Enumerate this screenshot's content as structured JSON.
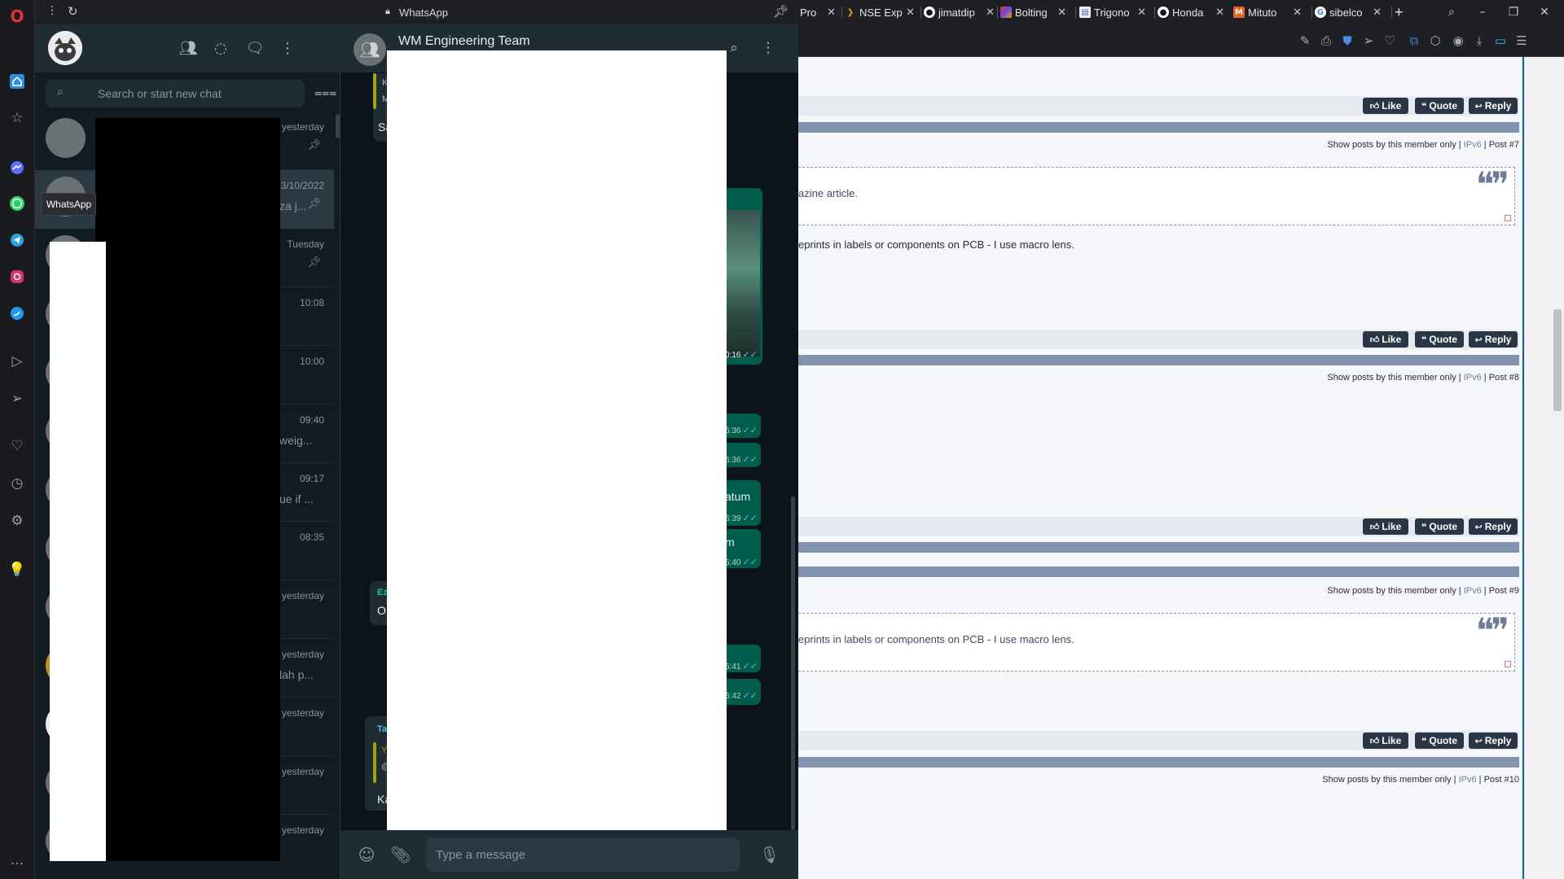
{
  "browser": {
    "tabs": [
      {
        "label": "Pro",
        "icon": "page-icon",
        "favicon_color": "#3d5a80"
      },
      {
        "label": "NSE Exp",
        "icon": "nse-icon",
        "favicon_color": "#f7a600"
      },
      {
        "label": "jimatdip",
        "icon": "github-icon",
        "favicon_color": "#ffffff"
      },
      {
        "label": "Bolting",
        "icon": "bolting-icon",
        "favicon_color": "#d6336c"
      },
      {
        "label": "Trigono",
        "icon": "doc-icon",
        "favicon_color": "#4a6fa5"
      },
      {
        "label": "Honda",
        "icon": "github-icon",
        "favicon_color": "#ffffff"
      },
      {
        "label": "Mituto",
        "icon": "m-icon",
        "favicon_color": "#e8631a"
      },
      {
        "label": "sibelco",
        "icon": "google-icon",
        "favicon_color": "#ffffff"
      }
    ],
    "new_tab_symbol": "+"
  },
  "whatsapp": {
    "window_title": "WhatsApp",
    "tooltip": "WhatsApp",
    "search_placeholder": "Search or start new chat",
    "chats": [
      {
        "time": "yesterday",
        "snippet": "",
        "pinned": true
      },
      {
        "time": "3/10/2022",
        "snippet": "za j...",
        "pinned": true
      },
      {
        "time": "Tuesday",
        "snippet": "",
        "pinned": true
      },
      {
        "time": "10:08",
        "snippet": "",
        "pinned": false
      },
      {
        "time": "10:00",
        "snippet": "",
        "pinned": false
      },
      {
        "time": "09:40",
        "snippet": "weig...",
        "pinned": false
      },
      {
        "time": "09:17",
        "snippet": "ue if ...",
        "pinned": false
      },
      {
        "time": "08:35",
        "snippet": "",
        "pinned": false
      },
      {
        "time": "yesterday",
        "snippet": "",
        "pinned": false
      },
      {
        "time": "yesterday",
        "snippet": "lah p...",
        "pinned": false
      },
      {
        "time": "yesterday",
        "snippet": "",
        "pinned": false
      },
      {
        "time": "yesterday",
        "snippet": "",
        "pinned": false
      },
      {
        "time": "yesterday",
        "snippet": "",
        "pinned": false
      }
    ],
    "conversation": {
      "name": "WM Engineering Team",
      "input_placeholder": "Type a message",
      "messages": {
        "m1_initial": "K",
        "m1_line2": "M",
        "m2": "Sa",
        "m3_time": "0:16",
        "m4_time": "6:36",
        "m5_time": "6:36",
        "m6_text": "atum",
        "m6_time": "6:39",
        "m7_text": "m",
        "m7_time": "6:40",
        "m8_sender": "Ez",
        "m8_text": "O",
        "m9_time": "6:41",
        "m10_time": "6:42",
        "m11_sender": "Ta",
        "m11_quote": "Y",
        "m11_quote2": "@",
        "m11_text": "Ka"
      }
    }
  },
  "forum": {
    "like": "Like",
    "quote": "Quote",
    "reply": "Reply",
    "posts": [
      {
        "info_prefix": "Show posts by this member only |",
        "info_ip": "IPv6",
        "info_suffix": "| Post #7"
      },
      {
        "info_prefix": "Show posts by this member only |",
        "info_ip": "IPv6",
        "info_suffix": "| Post #8"
      },
      {
        "info_prefix": "Show posts by this member only |",
        "info_ip": "IPv6",
        "info_suffix": "| Post #9"
      },
      {
        "info_prefix": "Show posts by this member only |",
        "info_ip": "IPv6",
        "info_suffix": "| Post #10"
      }
    ],
    "quote1": "azine article.",
    "text1": "eprints in labels or components on PCB - I use macro lens.",
    "quote2": "eprints in labels or components on PCB - I use macro lens."
  },
  "colors": {
    "wa_bg": "#111b21",
    "wa_panel": "#202c33",
    "wa_out_bubble": "#005c4b",
    "wa_ticks": "#53bdeb",
    "forum_btn": "#2a3545",
    "forum_sep": "#8293b0"
  }
}
